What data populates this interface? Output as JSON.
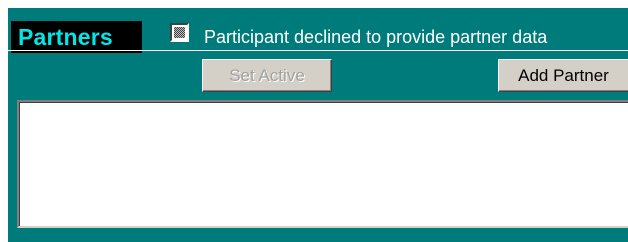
{
  "panel": {
    "title": "Partners",
    "colors": {
      "background": "#007b7b",
      "title_text": "#00e6e6",
      "title_tab": "#000000"
    }
  },
  "decline_option": {
    "label": "Participant declined to provide partner data",
    "state": "indeterminate"
  },
  "toolbar": {
    "set_active_label": "Set Active",
    "set_active_enabled": false,
    "add_partner_label": "Add Partner",
    "add_partner_enabled": true
  },
  "partner_list": {
    "items": []
  }
}
